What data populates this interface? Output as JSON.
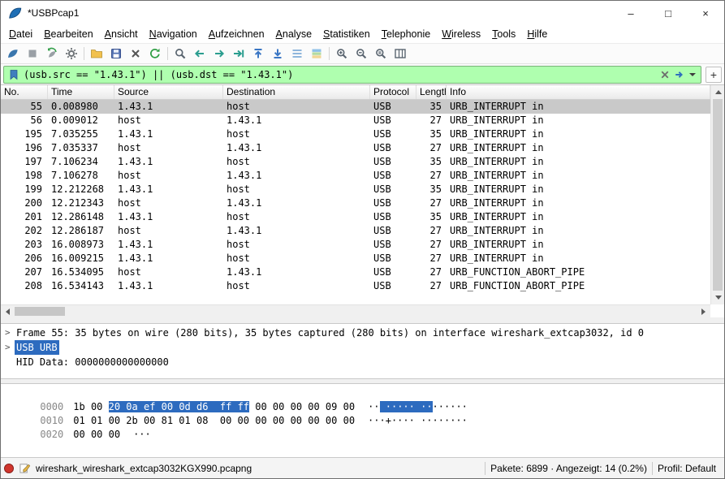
{
  "window": {
    "title": "*USBPcap1",
    "controls": {
      "minimize": "–",
      "maximize": "□",
      "close": "×"
    }
  },
  "menu": {
    "items": [
      "Datei",
      "Bearbeiten",
      "Ansicht",
      "Navigation",
      "Aufzeichnen",
      "Analyse",
      "Statistiken",
      "Telephonie",
      "Wireless",
      "Tools",
      "Hilfe"
    ]
  },
  "toolbar": {
    "icons": [
      "start-capture",
      "stop-capture",
      "restart-capture",
      "capture-options",
      "open-file",
      "save-file",
      "close-file",
      "reload-file",
      "find-packet",
      "go-back",
      "go-forward",
      "go-to-packet",
      "first-packet",
      "last-packet",
      "auto-scroll",
      "colorize-packets",
      "zoom-in",
      "zoom-out",
      "zoom-normal",
      "resize-columns"
    ]
  },
  "filter": {
    "value": "(usb.src == \"1.43.1\") || (usb.dst == \"1.43.1\")",
    "add_label": "+"
  },
  "packet_list": {
    "columns": [
      "No.",
      "Time",
      "Source",
      "Destination",
      "Protocol",
      "Length",
      "Info"
    ],
    "rows": [
      {
        "no": "55",
        "time": "0.008980",
        "source": "1.43.1",
        "destination": "host",
        "protocol": "USB",
        "length": "35",
        "info": "URB_INTERRUPT in",
        "selected": true
      },
      {
        "no": "56",
        "time": "0.009012",
        "source": "host",
        "destination": "1.43.1",
        "protocol": "USB",
        "length": "27",
        "info": "URB_INTERRUPT in",
        "selected": false
      },
      {
        "no": "195",
        "time": "7.035255",
        "source": "1.43.1",
        "destination": "host",
        "protocol": "USB",
        "length": "35",
        "info": "URB_INTERRUPT in",
        "selected": false
      },
      {
        "no": "196",
        "time": "7.035337",
        "source": "host",
        "destination": "1.43.1",
        "protocol": "USB",
        "length": "27",
        "info": "URB_INTERRUPT in",
        "selected": false
      },
      {
        "no": "197",
        "time": "7.106234",
        "source": "1.43.1",
        "destination": "host",
        "protocol": "USB",
        "length": "35",
        "info": "URB_INTERRUPT in",
        "selected": false
      },
      {
        "no": "198",
        "time": "7.106278",
        "source": "host",
        "destination": "1.43.1",
        "protocol": "USB",
        "length": "27",
        "info": "URB_INTERRUPT in",
        "selected": false
      },
      {
        "no": "199",
        "time": "12.212268",
        "source": "1.43.1",
        "destination": "host",
        "protocol": "USB",
        "length": "35",
        "info": "URB_INTERRUPT in",
        "selected": false
      },
      {
        "no": "200",
        "time": "12.212343",
        "source": "host",
        "destination": "1.43.1",
        "protocol": "USB",
        "length": "27",
        "info": "URB_INTERRUPT in",
        "selected": false
      },
      {
        "no": "201",
        "time": "12.286148",
        "source": "1.43.1",
        "destination": "host",
        "protocol": "USB",
        "length": "35",
        "info": "URB_INTERRUPT in",
        "selected": false
      },
      {
        "no": "202",
        "time": "12.286187",
        "source": "host",
        "destination": "1.43.1",
        "protocol": "USB",
        "length": "27",
        "info": "URB_INTERRUPT in",
        "selected": false
      },
      {
        "no": "203",
        "time": "16.008973",
        "source": "1.43.1",
        "destination": "host",
        "protocol": "USB",
        "length": "27",
        "info": "URB_INTERRUPT in",
        "selected": false
      },
      {
        "no": "206",
        "time": "16.009215",
        "source": "1.43.1",
        "destination": "host",
        "protocol": "USB",
        "length": "27",
        "info": "URB_INTERRUPT in",
        "selected": false
      },
      {
        "no": "207",
        "time": "16.534095",
        "source": "host",
        "destination": "1.43.1",
        "protocol": "USB",
        "length": "27",
        "info": "URB_FUNCTION_ABORT_PIPE",
        "selected": false
      },
      {
        "no": "208",
        "time": "16.534143",
        "source": "1.43.1",
        "destination": "host",
        "protocol": "USB",
        "length": "27",
        "info": "URB_FUNCTION_ABORT_PIPE",
        "selected": false
      }
    ]
  },
  "details": {
    "rows": [
      {
        "expander": ">",
        "text": "Frame 55: 35 bytes on wire (280 bits), 35 bytes captured (280 bits) on interface wireshark_extcap3032, id 0",
        "selected": false
      },
      {
        "expander": ">",
        "text": "USB URB",
        "selected": true
      },
      {
        "expander": "",
        "text": "HID Data: 0000000000000000",
        "selected": false
      }
    ]
  },
  "hex": {
    "rows": [
      {
        "offset": "0000",
        "hex_pre": "1b 00 ",
        "hex_sel": "20 0a ef 00 0d d6  ff ff",
        "hex_post": " 00 00 00 00 09 00",
        "ascii_pre": "··",
        "ascii_sel": " ····· ··",
        "ascii_post": "······"
      },
      {
        "offset": "0010",
        "hex_pre": "01 01 00 2b 00 81 01 08  00 00 00 00 00 00 00 00",
        "hex_sel": "",
        "hex_post": "",
        "ascii_pre": "···+···· ········",
        "ascii_sel": "",
        "ascii_post": ""
      },
      {
        "offset": "0020",
        "hex_pre": "00 00 00",
        "hex_sel": "",
        "hex_post": "",
        "ascii_pre": "···",
        "ascii_sel": "",
        "ascii_post": ""
      }
    ]
  },
  "status": {
    "filename": "wireshark_wireshark_extcap3032KGX990.pcapng",
    "packets": "Pakete: 6899 · Angezeigt: 14 (0.2%)",
    "profile": "Profil: Default"
  }
}
